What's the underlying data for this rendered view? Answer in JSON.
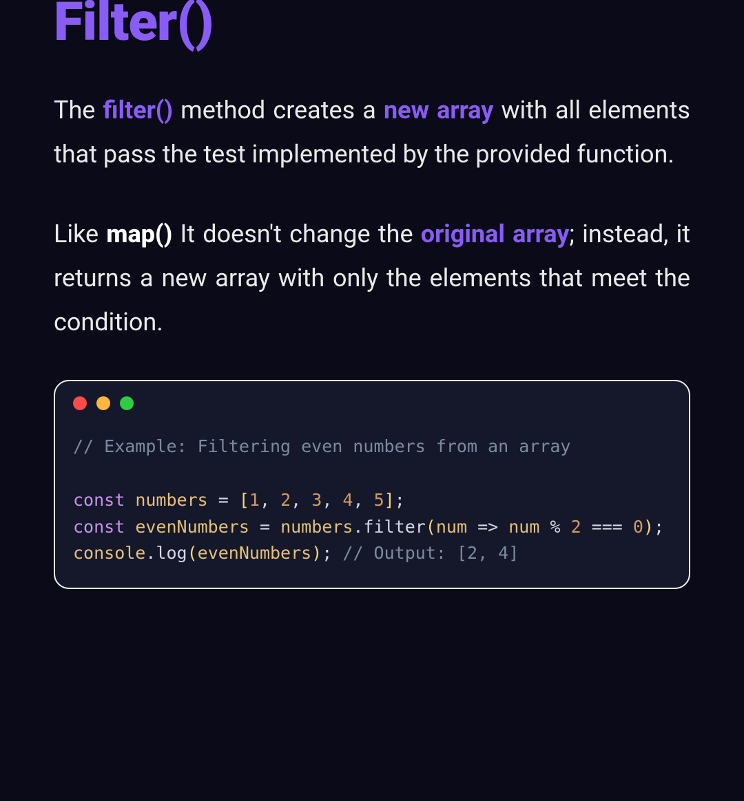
{
  "heading": "Filter()",
  "p1": {
    "t1": "The ",
    "h1": "filter()",
    "t2": " method creates a ",
    "h2": "new array",
    "t3": " with all elements that pass the test implemented by the provided function."
  },
  "p2": {
    "t1": "Like ",
    "b1": "map()",
    "t2": " It doesn't change the ",
    "h1": "original array",
    "t3": "; instead, it returns a new array with only the elements that meet the condition."
  },
  "code": {
    "comment": "// Example: Filtering even numbers from an array",
    "kw_const1": "const",
    "numbers_ident": "numbers",
    "eq": " = ",
    "arr_open": "[",
    "n1": "1",
    "c": ", ",
    "n2": "2",
    "n3": "3",
    "n4": "4",
    "n5": "5",
    "arr_close": "]",
    "semi": ";",
    "kw_const2": "const",
    "even_ident": "evenNumbers",
    "numbers_ref": "numbers",
    "dot": ".",
    "filter_call": "filter",
    "paren_open": "(",
    "param": "num",
    "arrow": " => ",
    "expr_left": "num ",
    "mod": "%",
    "expr_two": " 2 ",
    "triple_eq": "===",
    "zero": "0",
    "paren_close": ")",
    "console": "console",
    "log": "log",
    "arg": "evenNumbers",
    "out_comment": "// Output: [2, 4]"
  }
}
